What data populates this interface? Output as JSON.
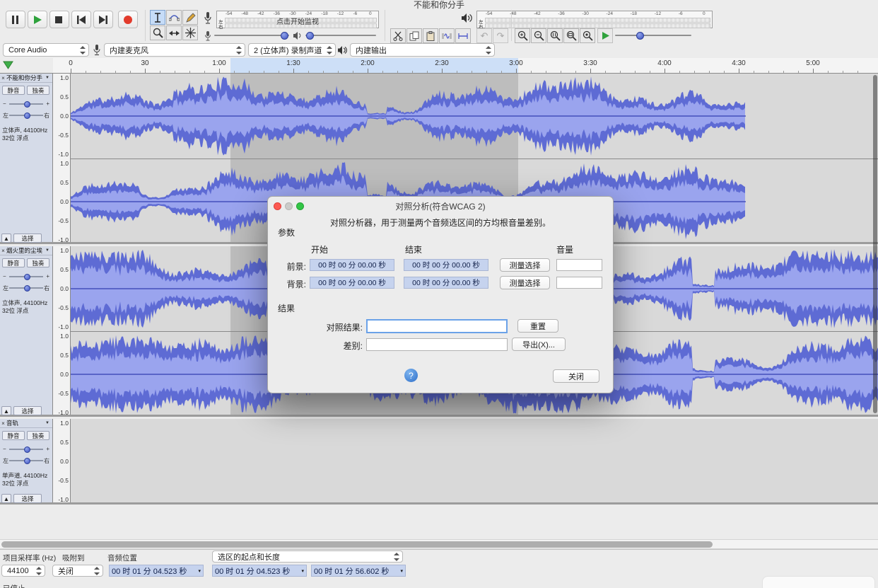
{
  "window": {
    "title": "不能和你分手"
  },
  "toolbar": {
    "monitor_text": "点击开始监视",
    "meter_ticks": [
      "-54",
      "-48",
      "-42",
      "-36",
      "-30",
      "-24",
      "-18",
      "-12",
      "-6",
      "0"
    ],
    "left_label": "左",
    "right_label": "右",
    "undo_icon": "↶",
    "redo_icon": "↷"
  },
  "device": {
    "host": "Core Audio",
    "input": "内建麦克风",
    "channels": "2 (立体声) 录制声道",
    "output": "内建输出"
  },
  "timeline": {
    "labels": [
      "0",
      "30",
      "1:00",
      "1:30",
      "2:00",
      "2:30",
      "3:00",
      "3:30",
      "4:00",
      "4:30",
      "5:00"
    ]
  },
  "scale": [
    "1.0",
    "0.5",
    "0.0",
    "-0.5",
    "-1.0"
  ],
  "track_labels": {
    "close": "×",
    "dropdown": "▼",
    "mute": "静音",
    "solo": "独奏",
    "minus": "−",
    "plus": "+",
    "left": "左",
    "right": "右",
    "collapse": "▲",
    "select": "选择"
  },
  "tracks": [
    {
      "name": "不能和你分手",
      "info1": "立体声, 44100Hz",
      "info2": "32位 浮点"
    },
    {
      "name": "烟火里的尘埃",
      "info1": "立体声, 44100Hz",
      "info2": "32位 浮点"
    },
    {
      "name": "音轨",
      "info1": "单声道, 44100Hz",
      "info2": "32位 浮点"
    }
  ],
  "dialog": {
    "title": "对照分析(符合WCAG 2)",
    "description": "对照分析器，用于测量两个音频选区间的方均根音量差别。",
    "params_label": "参数",
    "start_header": "开始",
    "end_header": "结束",
    "volume_header": "音量",
    "foreground_label": "前景:",
    "background_label": "背景:",
    "time_value": "00 时 00 分 00.00 秒",
    "measure_button": "测量选择",
    "results_label": "结果",
    "contrast_label": "对照结果:",
    "contrast_value": "",
    "reset_button": "重置",
    "difference_label": "差别:",
    "difference_value": "",
    "export_button": "导出(X)...",
    "help_icon": "?",
    "close_button": "关闭"
  },
  "status": {
    "rate_label": "项目采样率 (Hz)",
    "rate_value": "44100",
    "snap_label": "吸附到",
    "snap_value": "关闭",
    "position_label": "音频位置",
    "position_value": "00 时 01 分 04.523 秒",
    "selection_label": "选区的起点和长度",
    "selection_start": "00 时 01 分 04.523 秒",
    "selection_length": "00 时 01 分 56.602 秒",
    "state": "已停止",
    "caret": "▾"
  }
}
